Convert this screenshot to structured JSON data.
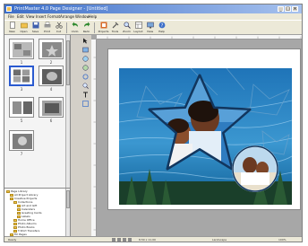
{
  "window": {
    "title": "PrintMaster 4.0 Page Designer - [Untitled]"
  },
  "menu": [
    "File",
    "Edit",
    "View",
    "Insert",
    "Format",
    "Arrange",
    "Window",
    "Help"
  ],
  "toolbar": {
    "buttons": [
      {
        "label": "New",
        "icon": "new-document-icon"
      },
      {
        "label": "Open",
        "icon": "open-folder-icon"
      },
      {
        "label": "Save",
        "icon": "save-disk-icon"
      },
      {
        "label": "Print",
        "icon": "printer-icon"
      },
      {
        "label": "Cut",
        "icon": "scissors-icon"
      },
      {
        "label": "Undo",
        "icon": "undo-arrow-icon"
      },
      {
        "label": "Redo",
        "icon": "redo-arrow-icon"
      },
      {
        "label": "Projects",
        "icon": "projects-icon"
      },
      {
        "label": "Tools",
        "icon": "tools-icon"
      },
      {
        "label": "Zoom",
        "icon": "zoom-icon"
      },
      {
        "label": "Layout",
        "icon": "layout-icon"
      },
      {
        "label": "View",
        "icon": "view-icon"
      },
      {
        "label": "Help",
        "icon": "help-icon"
      }
    ]
  },
  "thumbnails": {
    "pages": [
      "1",
      "2",
      "3",
      "4",
      "5",
      "6",
      "7"
    ],
    "selected": "2"
  },
  "tree": {
    "items": [
      "Page Library",
      "All Project Library",
      "Creative Projects",
      "Collections",
      "Art and Gift",
      "Calendars",
      "Greeting Cards",
      "Labels",
      "Home Office",
      "Photo Albums",
      "Photo Books",
      "T-Shirt Transfers",
      "Fill Pages",
      "Standard Photo Sizes"
    ]
  },
  "status": {
    "left": "Ready",
    "size": "8.50 x 11.00",
    "orientation": "Landscape",
    "zoom": "100%"
  }
}
